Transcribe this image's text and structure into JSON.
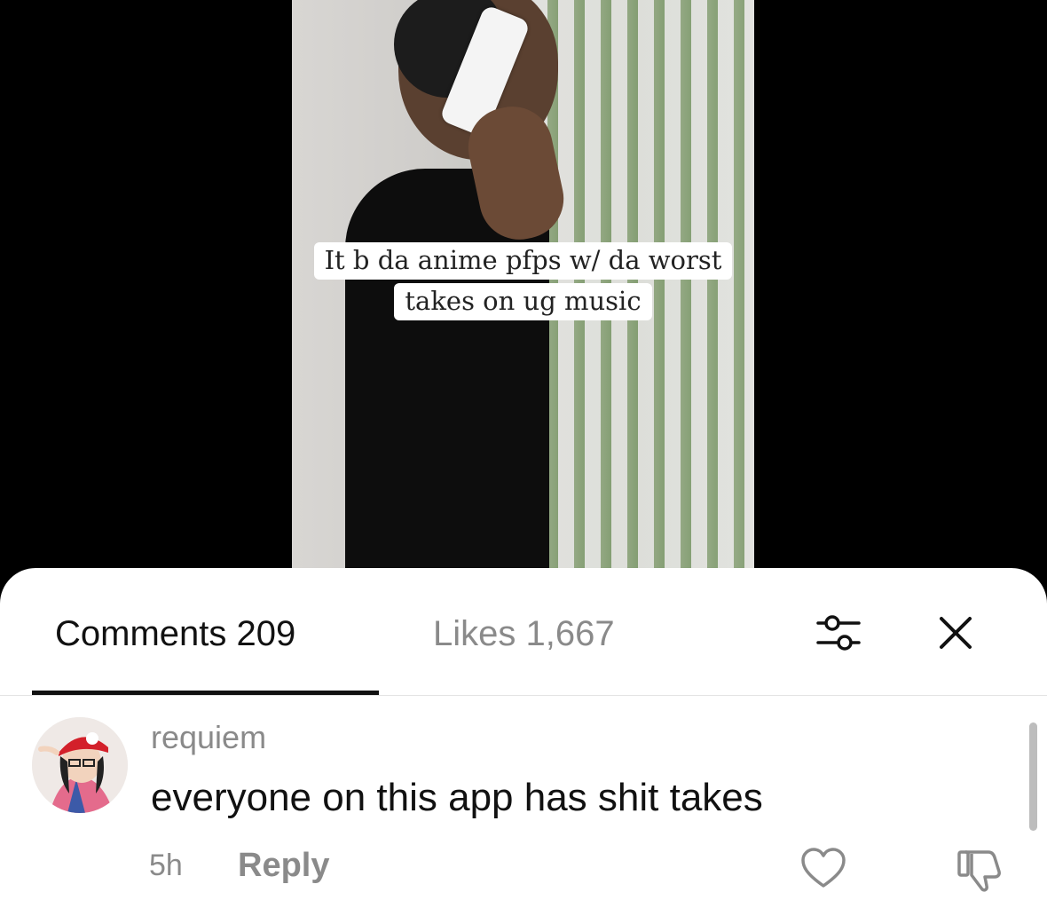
{
  "video": {
    "caption_line1": "It b da anime pfps w/ da worst",
    "caption_line2": "takes on ug music"
  },
  "tabs": {
    "comments_label": "Comments 209",
    "likes_label": "Likes 1,667"
  },
  "icons": {
    "filter": "sliders-filter-icon",
    "close": "close-icon",
    "like": "heart-icon",
    "dislike": "thumbs-down-icon"
  },
  "comments": [
    {
      "username": "requiem",
      "text": "everyone on this app has shit takes",
      "time": "5h",
      "reply_label": "Reply"
    }
  ],
  "colors": {
    "primary_text": "#111111",
    "secondary_text": "#8a8a8a",
    "background": "#ffffff"
  }
}
